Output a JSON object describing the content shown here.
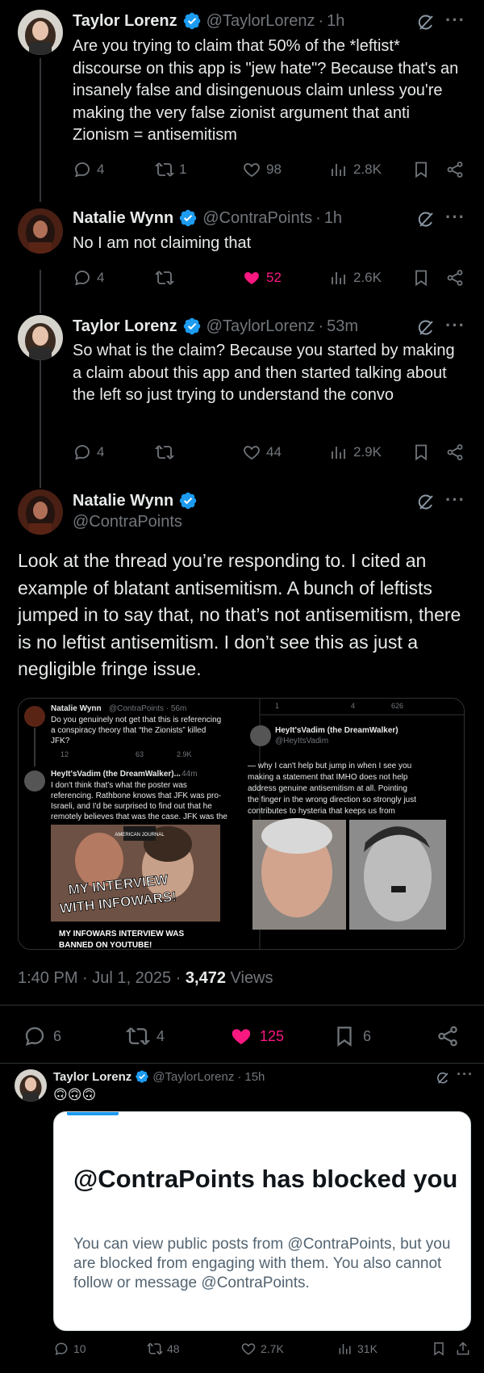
{
  "thread": {
    "replies": [
      {
        "name": "Taylor Lorenz",
        "handle": "@TaylorLorenz",
        "time": "1h",
        "avatar": "taylor-avatar",
        "text": "Are you trying to claim that 50% of the *leftist* discourse on this app is \"jew hate\"? Because that's an insanely false and disingenuous claim unless you're making the very false zionist argument that anti Zionism = antisemitism",
        "stats": {
          "replies": "4",
          "reposts": "1",
          "likes": "98",
          "views": "2.8K"
        },
        "liked": false
      },
      {
        "name": "Natalie Wynn",
        "handle": "@ContraPoints",
        "time": "1h",
        "avatar": "natalie-avatar",
        "text": "No I am not claiming that",
        "stats": {
          "replies": "4",
          "reposts": "",
          "likes": "52",
          "views": "2.6K"
        },
        "liked": true
      },
      {
        "name": "Taylor Lorenz",
        "handle": "@TaylorLorenz",
        "time": "53m",
        "avatar": "taylor-avatar",
        "text": "So what is the claim? Because you started by making a claim about this app and then started talking about the left so just trying to understand the convo",
        "stats": {
          "replies": "4",
          "reposts": "",
          "likes": "44",
          "views": "2.9K"
        },
        "liked": false
      }
    ]
  },
  "main_post": {
    "name": "Natalie Wynn",
    "handle": "@ContraPoints",
    "text": "Look at the thread you’re responding to. I cited an example of blatant antisemitism. A bunch of leftists jumped in to say that, no that’s not antisemitism, there is no leftist antisemitism. I don’t see this as just a negligible fringe issue.",
    "timestamp": "1:40 PM · Jul 1, 2025 · ",
    "views_count": "3,472",
    "views_label": "Views",
    "stats": {
      "replies": "6",
      "reposts": "4",
      "likes": "125",
      "bookmarks": "6"
    },
    "embedded": {
      "left_post": {
        "name": "Natalie Wynn",
        "handle": "@ContraPoints · 56m",
        "text1": "Do you genuinely not get that this is referencing",
        "text2": "a conspiracy theory that “the Zionists” killed",
        "text3": "JFK?",
        "stats": [
          "12",
          "",
          "63",
          "2.9K"
        ]
      },
      "left_reply": {
        "name": "HeyIt'sVadim (the DreamWalker)...",
        "time": "· 44m",
        "lines": [
          "I don't think that's what the poster was",
          "referencing. Rathbone knows that JFK was pro-",
          "Israeli, and I'd be surprised to find out that he",
          "remotely believes that was the case. JFK was the"
        ],
        "thumb_caption1": "MY INTERVIEW",
        "thumb_caption2": "WITH INFOWARS!",
        "thumb_brand": "AMERICAN JOURNAL",
        "thumb_bottom": "MY INFOWARS INTERVIEW WAS",
        "thumb_bottom2": "BANNED ON YOUTUBE!"
      },
      "right_stats": [
        "1",
        "",
        "4",
        "626"
      ],
      "right_post": {
        "name": "HeyIt'sVadim (the DreamWalker)",
        "handle": "@HeyItsVadim",
        "lines": [
          "— why I can't help but jump in when I see you",
          "making a statement that IMHO does not help",
          "address genuine antisemitism at all. Pointing",
          "the finger in the wrong direction so strongly just",
          "contributes to hysteria that keeps us from"
        ]
      }
    }
  },
  "quote_reply": {
    "name": "Taylor Lorenz",
    "handle": "@TaylorLorenz",
    "time": "15h",
    "emoji": "🙃🙃🙃",
    "card": {
      "title": "@ContraPoints has blocked you",
      "description": "You can view public posts from @ContraPoints, but you are blocked from engaging with them. You also cannot follow or message @ContraPoints."
    },
    "stats": {
      "replies": "10",
      "reposts": "48",
      "likes": "2.7K",
      "views": "31K"
    }
  },
  "colors": {
    "accent": "#1d9bf0",
    "like": "#f91880",
    "muted": "#71767b",
    "bg": "#000000"
  },
  "separator": "·",
  "more": "···"
}
